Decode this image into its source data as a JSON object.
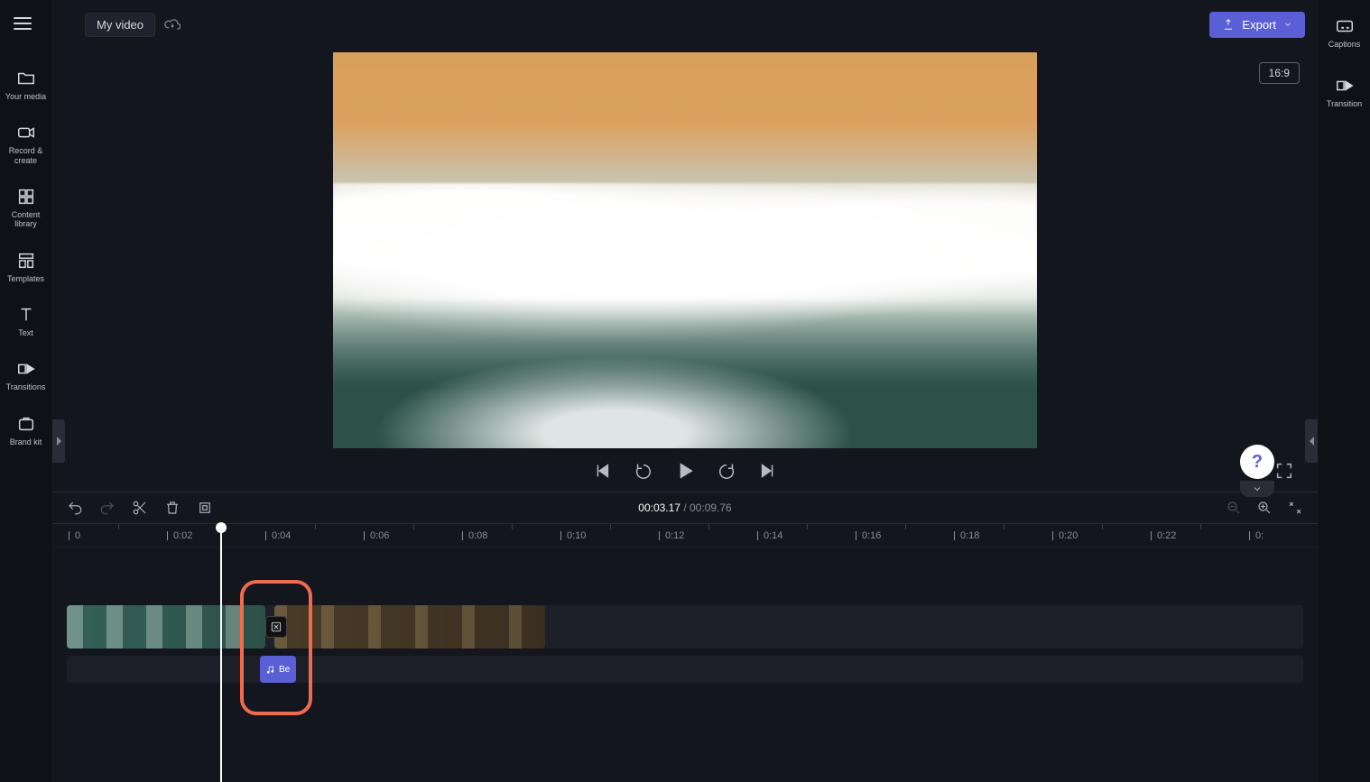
{
  "header": {
    "title": "My video",
    "export_label": "Export"
  },
  "aspect_badge": "16:9",
  "left_rail": [
    {
      "id": "your-media",
      "label": "Your media"
    },
    {
      "id": "record-create",
      "label": "Record & create"
    },
    {
      "id": "content-library",
      "label": "Content library"
    },
    {
      "id": "templates",
      "label": "Templates"
    },
    {
      "id": "text",
      "label": "Text"
    },
    {
      "id": "transitions",
      "label": "Transitions"
    },
    {
      "id": "brand-kit",
      "label": "Brand kit"
    }
  ],
  "right_rail": [
    {
      "id": "captions",
      "label": "Captions"
    },
    {
      "id": "transition",
      "label": "Transition"
    }
  ],
  "timecode": {
    "current": "00:03.17",
    "separator": " / ",
    "total": "00:09.76"
  },
  "ruler_ticks": [
    "0",
    "0:02",
    "0:04",
    "0:06",
    "0:08",
    "0:10",
    "0:12",
    "0:14",
    "0:16",
    "0:18",
    "0:20",
    "0:22",
    "0:"
  ],
  "audio_clip_label": "Be",
  "help_glyph": "?",
  "colors": {
    "accent": "#5b5fd6",
    "highlight": "#ef6a4e"
  }
}
